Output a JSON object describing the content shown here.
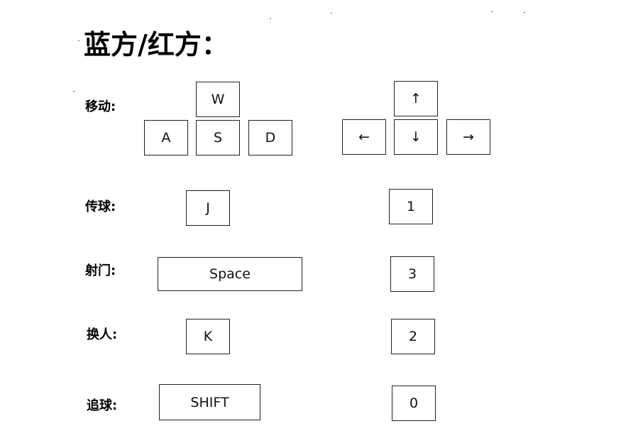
{
  "title": "蓝方/红方：",
  "actions": [
    {
      "id": "move",
      "label": "移动:"
    },
    {
      "id": "pass",
      "label": "传球:"
    },
    {
      "id": "shoot",
      "label": "射门:"
    },
    {
      "id": "switch",
      "label": "换人:"
    },
    {
      "id": "chase",
      "label": "追球:"
    }
  ],
  "blue_keys": {
    "move_up": "W",
    "move_left": "A",
    "move_down": "S",
    "move_right": "D",
    "pass": "J",
    "shoot": "Space",
    "switch": "K",
    "chase": "SHIFT"
  },
  "red_keys": {
    "move_up": "↑",
    "move_left": "←",
    "move_down": "↓",
    "move_right": "→",
    "pass": "1",
    "shoot": "3",
    "switch": "2",
    "chase": "0"
  }
}
